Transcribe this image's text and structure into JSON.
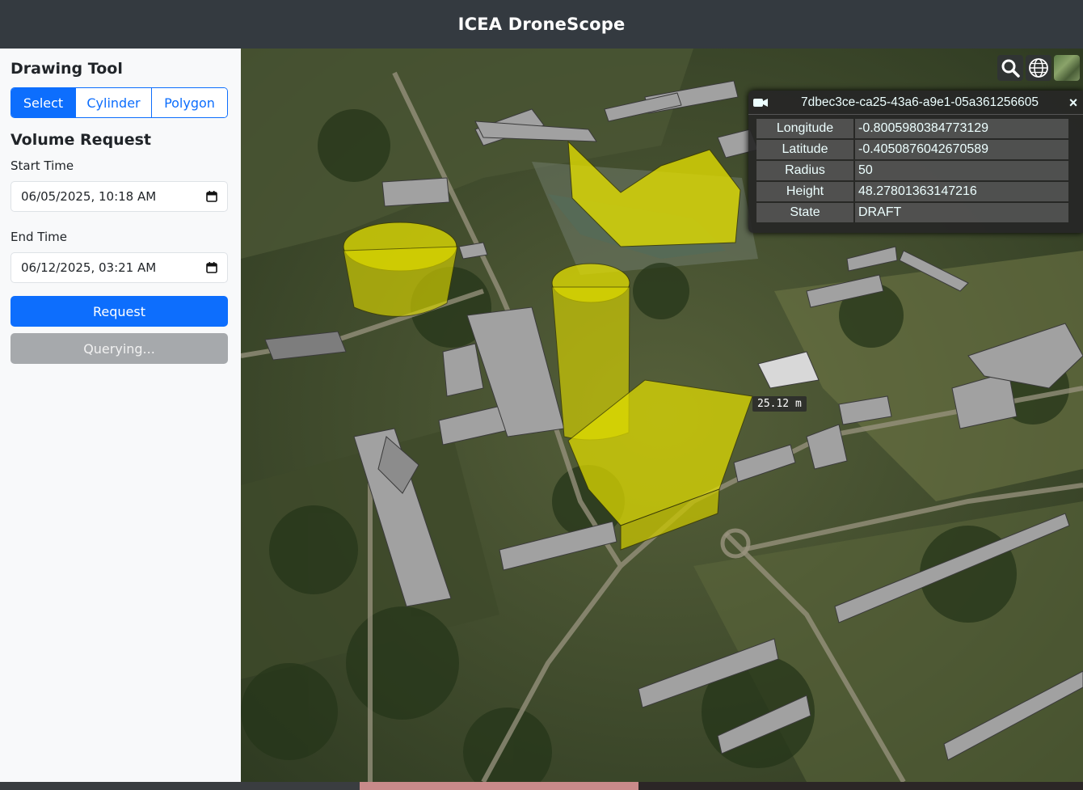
{
  "app": {
    "title": "ICEA DroneScope"
  },
  "sidebar": {
    "drawing_tool": {
      "heading": "Drawing Tool",
      "modes": [
        {
          "label": "Select",
          "active": true
        },
        {
          "label": "Cylinder",
          "active": false
        },
        {
          "label": "Polygon",
          "active": false
        }
      ]
    },
    "volume_request": {
      "heading": "Volume Request",
      "start_label": "Start Time",
      "start_value": "06/05/2025, 10:18 AM",
      "end_label": "End Time",
      "end_value": "06/12/2025, 03:21 AM",
      "request_label": "Request",
      "querying_label": "Querying..."
    }
  },
  "infobox": {
    "title": "7dbec3ce-ca25-43a6-a9e1-05a361256605",
    "close_glyph": "×",
    "rows": [
      {
        "key": "Longitude",
        "value": "-0.8005980384773129"
      },
      {
        "key": "Latitude",
        "value": "-0.4050876042670589"
      },
      {
        "key": "Radius",
        "value": "50"
      },
      {
        "key": "Height",
        "value": "48.27801363147216"
      },
      {
        "key": "State",
        "value": "DRAFT"
      }
    ]
  },
  "map": {
    "measurement_label": "25.12 m",
    "toolbar_icons": [
      "search-icon",
      "globe-icon",
      "imagery-layer-icon"
    ],
    "colors": {
      "volume_fill": "#e6e600",
      "building": "#9a9a9a",
      "terrain": "#46522f"
    }
  }
}
